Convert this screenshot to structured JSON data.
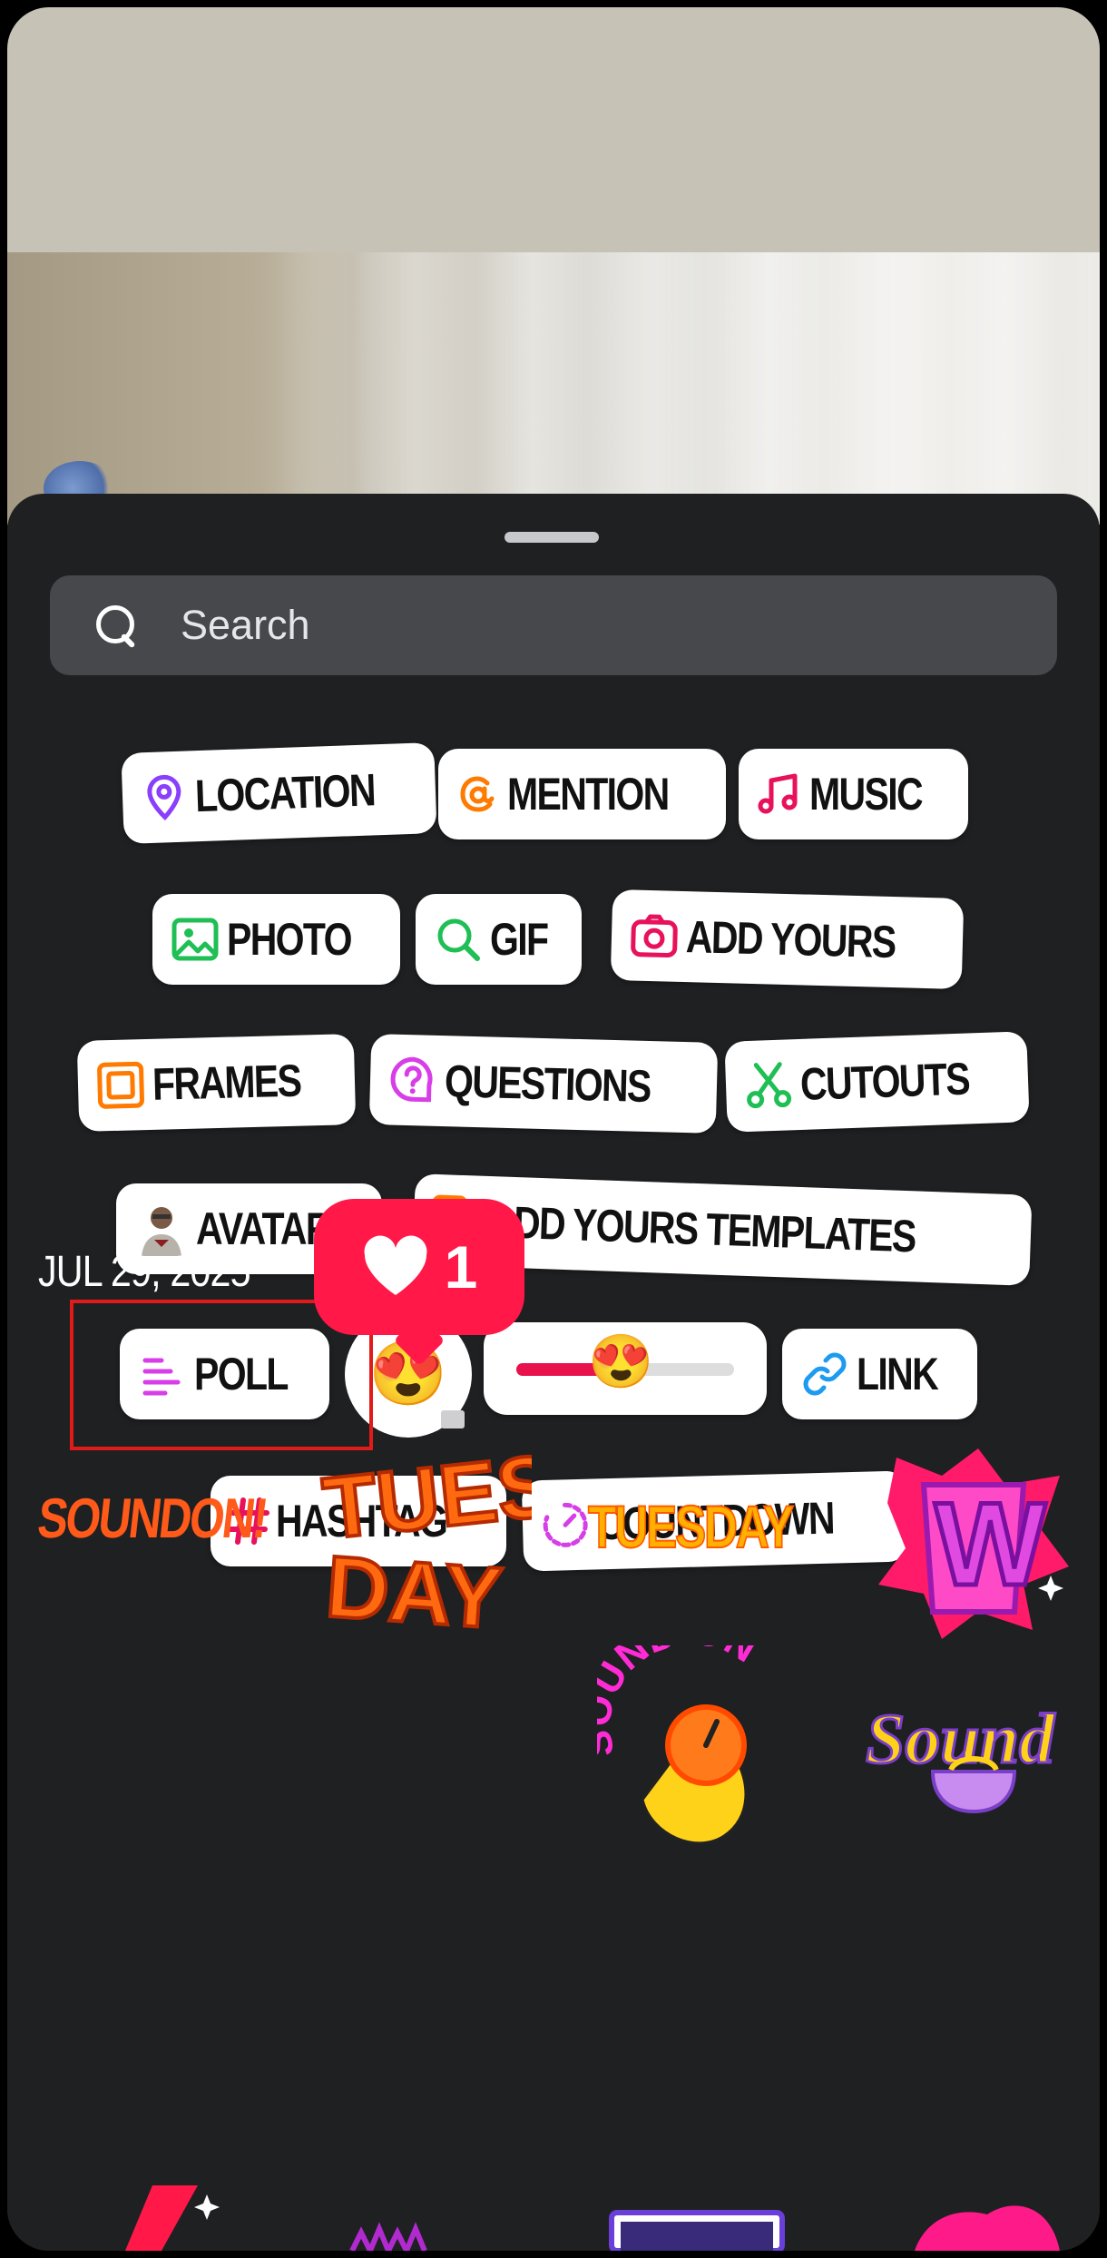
{
  "search": {
    "placeholder": "Search"
  },
  "stickers": {
    "location": "LOCATION",
    "mention": "MENTION",
    "music": "MUSIC",
    "photo": "PHOTO",
    "gif": "GIF",
    "add_yours": "ADD YOURS",
    "frames": "FRAMES",
    "questions": "QUESTIONS",
    "cutouts": "CUTOUTS",
    "avatar": "AVATAR",
    "add_yours_templates": "ADD YOURS TEMPLATES",
    "poll": "POLL",
    "emoji_reaction": "😍",
    "emoji_slider_thumb": "😍",
    "emoji_slider_level": 0.45,
    "link": "LINK",
    "hashtag": "HASHTAG",
    "countdown": "COUNTDOWN"
  },
  "gallery": {
    "date": "JUL 29, 2025",
    "like_count": "1",
    "sound_on_arc": "SOUND ON",
    "sound_script": "Sound",
    "sound_on_orange": "SOUNDON!",
    "tues_day": [
      "TUES",
      "DAY"
    ],
    "tuesday": "TUESDAY",
    "w_letter": "W"
  },
  "colors": {
    "location": "#8a3ffc",
    "mention": "#ff7a00",
    "music": "#e8115b",
    "photo": "#1fbf55",
    "gif": "#1fbf55",
    "add_yours": "#e8115b",
    "frames": "#ff7a00",
    "questions": "#d83ee8",
    "cutouts": "#1fbf55",
    "templates": "#ff7a00",
    "poll": "#d83ee8",
    "link": "#1d9bf0",
    "hashtag": "#e8115b",
    "countdown": "#d83ee8",
    "like": "#ff1848"
  }
}
